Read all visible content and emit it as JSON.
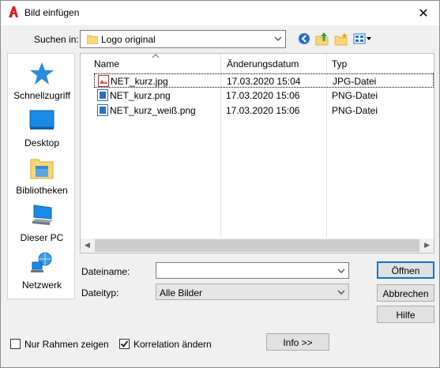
{
  "titlebar": {
    "title": "Bild einfügen",
    "close_glyph": "✕"
  },
  "lookin": {
    "label": "Suchen in:",
    "value": "Logo original"
  },
  "places": [
    {
      "label": "Schnellzugriff"
    },
    {
      "label": "Desktop"
    },
    {
      "label": "Bibliotheken"
    },
    {
      "label": "Dieser PC"
    },
    {
      "label": "Netzwerk"
    }
  ],
  "filelist": {
    "columns": {
      "name": "Name",
      "date": "Änderungsdatum",
      "type": "Typ"
    },
    "rows": [
      {
        "name": "NET_kurz.jpg",
        "date": "17.03.2020 15:04",
        "type": "JPG-Datei",
        "icon": "jpg-file-icon"
      },
      {
        "name": "NET_kurz.png",
        "date": "17.03.2020 15:06",
        "type": "PNG-Datei",
        "icon": "png-file-icon"
      },
      {
        "name": "NET_kurz_weiß.png",
        "date": "17.03.2020 15:06",
        "type": "PNG-Datei",
        "icon": "png-file-icon"
      }
    ]
  },
  "form": {
    "filename_label": "Dateiname:",
    "filename_value": "",
    "filetype_label": "Dateityp:",
    "filetype_value": "Alle Bilder"
  },
  "buttons": {
    "open": "Öffnen",
    "cancel": "Abbrechen",
    "help": "Hilfe",
    "info": "Info >>"
  },
  "options": {
    "frame_only": {
      "label": "Nur Rahmen zeigen",
      "checked": false
    },
    "correlation": {
      "label": "Korrelation ändern",
      "checked": true
    }
  },
  "colors": {
    "accent": "#0078d7",
    "selection_border": "#000000"
  }
}
